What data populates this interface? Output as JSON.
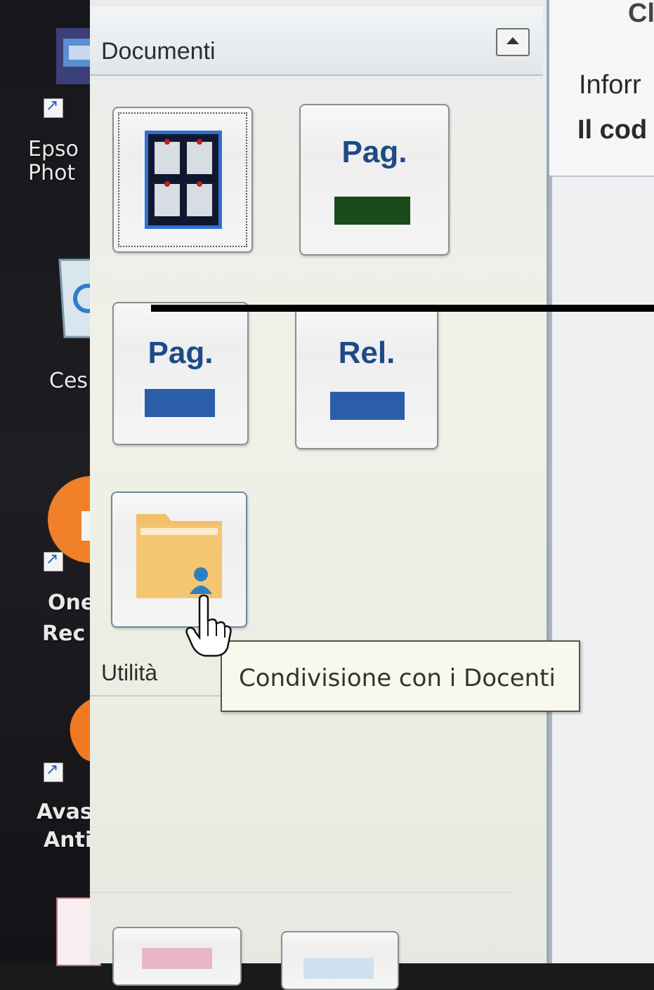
{
  "desktop": {
    "icons": [
      {
        "label_lines": [
          "Epso",
          "Phot"
        ]
      },
      {
        "label_lines": [
          "Ces"
        ]
      },
      {
        "label_lines": [
          "One",
          "Rec"
        ]
      },
      {
        "label_lines": [
          "Avas",
          "Anti"
        ]
      }
    ]
  },
  "panel": {
    "title": "Documenti",
    "tiles": [
      {
        "label": "Pag.",
        "color": "#1b4a1b"
      },
      {
        "label": "Pag.",
        "color": "#2a5ea8"
      },
      {
        "label": "Rel.",
        "color": "#2a5ea8"
      }
    ],
    "section": "Utilità"
  },
  "right": {
    "title": "Cl",
    "line1": "Inforr",
    "line2": "Il cod"
  },
  "tooltip": "Condivisione con i Docenti",
  "colors": {
    "panel_bg": "#eef0e8",
    "tile_label": "#1e4a86",
    "dark_green_bar": "#1b4a1b",
    "blue_bar": "#2a5ea8",
    "folder": "#f2c06c"
  }
}
